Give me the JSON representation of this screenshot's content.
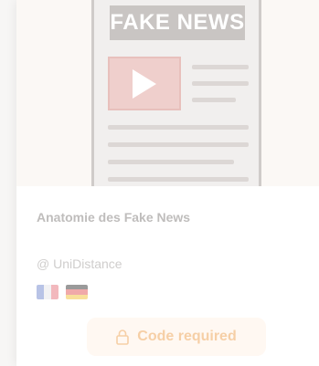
{
  "card": {
    "thumbnail": {
      "banner_text": "FAKE NEWS",
      "icon": "play-icon"
    },
    "title": "Anatomie des Fake News",
    "author": "@ UniDistance",
    "languages": [
      {
        "code": "fr",
        "icon": "flag-france-icon"
      },
      {
        "code": "de",
        "icon": "flag-germany-icon"
      }
    ],
    "action": {
      "label": "Code required",
      "icon": "lock-icon"
    }
  },
  "colors": {
    "accent": "#f6cfa6",
    "accent_bg": "#fff8f2",
    "title": "#bfbdbc",
    "video_red": "#efcfcc"
  }
}
